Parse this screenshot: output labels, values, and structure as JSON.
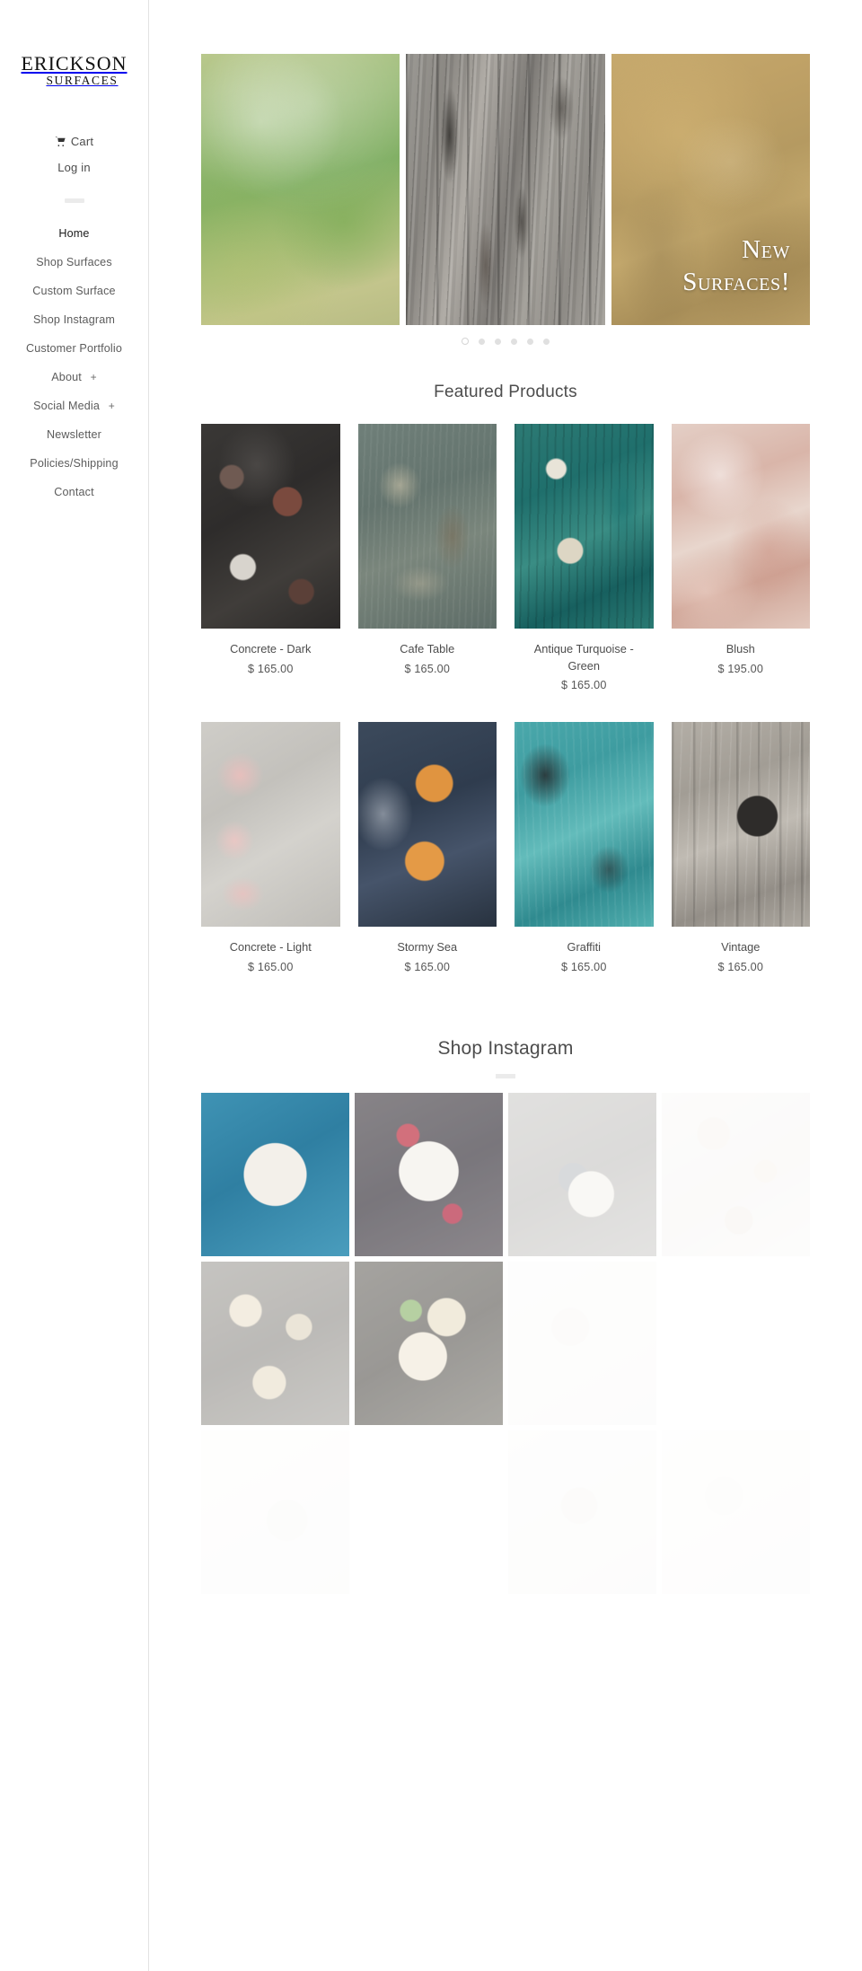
{
  "brand": {
    "logo_line1": "ERICKSON",
    "logo_line2": "SURFACES"
  },
  "sidebar": {
    "cart_label": "Cart",
    "login_label": "Log in",
    "nav": [
      {
        "label": "Home",
        "active": true,
        "expandable": false
      },
      {
        "label": "Shop Surfaces",
        "active": false,
        "expandable": false
      },
      {
        "label": "Custom Surface",
        "active": false,
        "expandable": false
      },
      {
        "label": "Shop Instagram",
        "active": false,
        "expandable": false
      },
      {
        "label": "Customer Portfolio",
        "active": false,
        "expandable": false
      },
      {
        "label": "About",
        "active": false,
        "expandable": true,
        "expand_glyph": "+"
      },
      {
        "label": "Social Media",
        "active": false,
        "expandable": true,
        "expand_glyph": "+"
      },
      {
        "label": "Newsletter",
        "active": false,
        "expandable": false
      },
      {
        "label": "Policies/Shipping",
        "active": false,
        "expandable": false
      },
      {
        "label": "Contact",
        "active": false,
        "expandable": false
      }
    ]
  },
  "hero": {
    "slides": [
      {
        "name": "green-watercolor-surface",
        "caption": ""
      },
      {
        "name": "weathered-gray-wood-surface",
        "caption": ""
      },
      {
        "name": "golden-tan-surface",
        "caption_line1": "New",
        "caption_line2": "Surfaces!"
      }
    ],
    "dots": [
      {
        "active": true
      },
      {
        "active": false
      },
      {
        "active": false
      },
      {
        "active": false
      },
      {
        "active": false
      },
      {
        "active": false
      }
    ]
  },
  "featured": {
    "title": "Featured Products",
    "row1": [
      {
        "title": "Concrete - Dark",
        "price": "$ 165.00",
        "swatch": "t-concrete-dark"
      },
      {
        "title": "Cafe Table",
        "price": "$ 165.00",
        "swatch": "t-cafe-table"
      },
      {
        "title": "Antique Turquoise - Green",
        "price": "$ 165.00",
        "swatch": "t-antique-turq"
      },
      {
        "title": "Blush",
        "price": "$ 195.00",
        "swatch": "t-blush"
      }
    ],
    "row2": [
      {
        "title": "Concrete - Light",
        "price": "$ 165.00",
        "swatch": "t-concrete-light"
      },
      {
        "title": "Stormy Sea",
        "price": "$ 165.00",
        "swatch": "t-stormy-sea"
      },
      {
        "title": "Graffiti",
        "price": "$ 165.00",
        "swatch": "t-graffiti"
      },
      {
        "title": "Vintage",
        "price": "$ 165.00",
        "swatch": "t-vintage"
      }
    ]
  },
  "instagram": {
    "title": "Shop Instagram",
    "row1": [
      {
        "name": "insta-blue-bowl",
        "style": "g-blue",
        "opacity": 1
      },
      {
        "name": "insta-berry-bowl",
        "style": "g-berry",
        "opacity": 0.72
      },
      {
        "name": "insta-gray-noodles",
        "style": "g-gray",
        "opacity": 0.34
      },
      {
        "name": "insta-pale-spread",
        "style": "g-pale",
        "opacity": 0.22
      }
    ],
    "row2": [
      {
        "name": "insta-cheese-board",
        "style": "g-board",
        "opacity": 0.5
      },
      {
        "name": "insta-ramen-bowls",
        "style": "g-ramen",
        "opacity": 0.62
      },
      {
        "name": "insta-faint-tile-a",
        "style": "g-faint-a",
        "opacity": 0.2
      },
      {
        "name": "insta-empty-tile-a",
        "style": "g-empty",
        "opacity": 0
      }
    ],
    "row3": [
      {
        "name": "insta-faint-tile-b",
        "style": "g-faint-b",
        "opacity": 0.16
      },
      {
        "name": "insta-empty-tile-b",
        "style": "g-empty",
        "opacity": 0
      },
      {
        "name": "insta-faint-tile-c",
        "style": "g-faint-c",
        "opacity": 0.18
      },
      {
        "name": "insta-faint-tile-d",
        "style": "g-faint-a",
        "opacity": 0.12
      }
    ]
  },
  "colors": {
    "border": "#e3e3e3",
    "text": "#4d4d4d",
    "muted": "#5c5c5c",
    "divider": "#ebebeb"
  }
}
